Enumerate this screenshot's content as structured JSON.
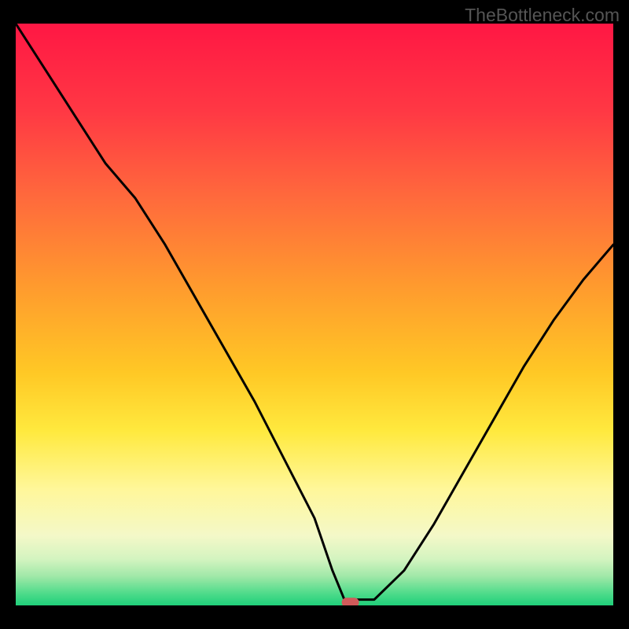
{
  "watermark": "TheBottleneck.com",
  "chart_data": {
    "type": "line",
    "title": "",
    "xlabel": "",
    "ylabel": "",
    "xlim": [
      0,
      100
    ],
    "ylim": [
      0,
      100
    ],
    "x": [
      0,
      5,
      10,
      15,
      20,
      25,
      30,
      35,
      40,
      45,
      50,
      53,
      55,
      57,
      60,
      65,
      70,
      75,
      80,
      85,
      90,
      95,
      100
    ],
    "values": [
      100,
      92,
      84,
      76,
      70,
      62,
      53,
      44,
      35,
      25,
      15,
      6,
      1,
      1,
      1,
      6,
      14,
      23,
      32,
      41,
      49,
      56,
      62
    ],
    "marker_point": {
      "x": 56,
      "y": 0.5
    },
    "gradient_stops": [
      {
        "offset": 0,
        "color": "#ff1744"
      },
      {
        "offset": 15,
        "color": "#ff3844"
      },
      {
        "offset": 30,
        "color": "#ff6a3c"
      },
      {
        "offset": 45,
        "color": "#ff9a2e"
      },
      {
        "offset": 60,
        "color": "#ffc825"
      },
      {
        "offset": 70,
        "color": "#ffe93e"
      },
      {
        "offset": 80,
        "color": "#fff79a"
      },
      {
        "offset": 88,
        "color": "#f4f8c8"
      },
      {
        "offset": 92,
        "color": "#d4f4c0"
      },
      {
        "offset": 95,
        "color": "#a0e8a8"
      },
      {
        "offset": 98,
        "color": "#4ddb8a"
      },
      {
        "offset": 100,
        "color": "#1fcf7a"
      }
    ],
    "marker_color": "#d05a5a",
    "line_color": "#000000"
  }
}
